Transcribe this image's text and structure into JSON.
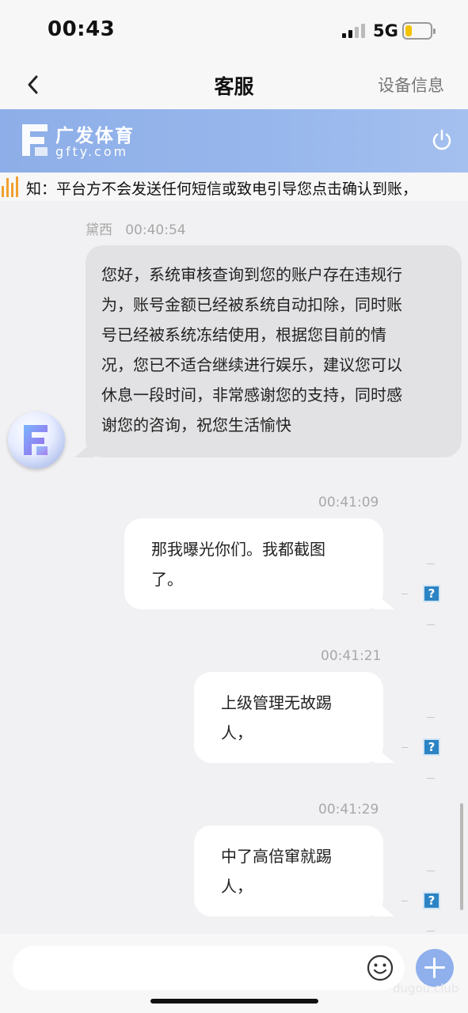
{
  "status_bar": {
    "time": "00:43",
    "network": "5G",
    "battery_level": 0.25,
    "battery_color": "#f4c300"
  },
  "nav": {
    "title": "客服",
    "right_label": "设备信息",
    "back_icon": "chevron-left-icon"
  },
  "brand": {
    "name": "广发体育",
    "domain": "gfty.com",
    "power_icon": "power-icon"
  },
  "notice": {
    "text": "知：平台方不会发送任何短信或致电引导您点击确认到账，"
  },
  "messages": [
    {
      "direction": "incoming",
      "sender": "黛西",
      "time": "00:40:54",
      "lines": [
        "您好，系统审核查询到您的账户存在违规行",
        "为，账号金额已经被系统自动扣除，同时账",
        "号已经被系统冻结使用，根据您目前的情",
        "况，您已不适合继续进行娱乐，建议您可以",
        "休息一段时间，非常感谢您的支持，同时感",
        "谢您的咨询，祝您生活愉快"
      ]
    },
    {
      "direction": "outgoing",
      "time": "00:41:09",
      "lines": [
        "那我曝光你们。我都截图",
        "了。"
      ],
      "status": "?"
    },
    {
      "direction": "outgoing",
      "time": "00:41:21",
      "lines": [
        "上级管理无故踢",
        "人，"
      ],
      "status": "?"
    },
    {
      "direction": "outgoing",
      "time": "00:41:29",
      "lines": [
        "中了高倍窜就踢",
        "人，"
      ],
      "status": "?"
    }
  ],
  "input": {
    "placeholder": "",
    "emoji_icon": "smiley-icon",
    "plus_icon": "plus-icon"
  },
  "watermark": "dugou.club",
  "colors": {
    "brand_header": "#94b4ea",
    "plus_button": "#8fb0ec",
    "status_icon": "#2c84c4",
    "notice_bars": "#f0a030"
  }
}
